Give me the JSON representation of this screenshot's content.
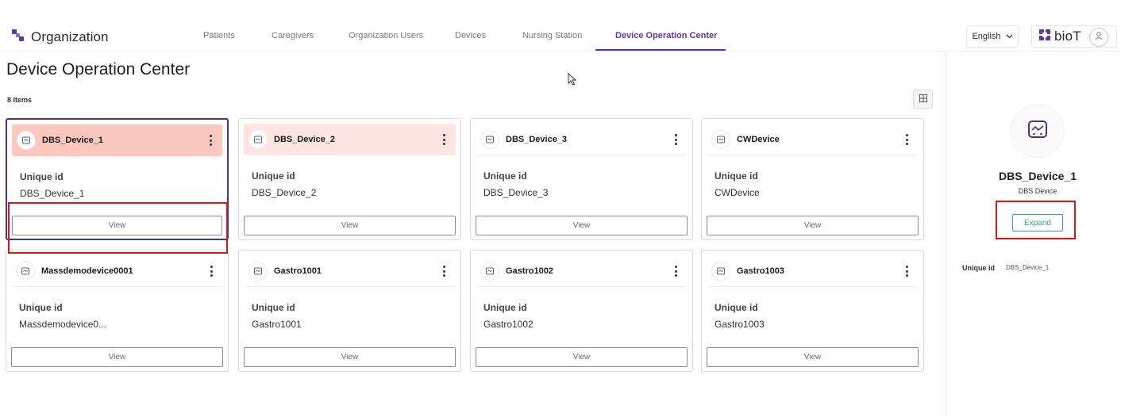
{
  "header": {
    "org_title": "Organization",
    "language": "English",
    "logo_text": "bioT",
    "nav": [
      {
        "label": "Patients",
        "active": false
      },
      {
        "label": "Caregivers",
        "active": false
      },
      {
        "label": "Organization Users",
        "active": false
      },
      {
        "label": "Devices",
        "active": false
      },
      {
        "label": "Nursing Station",
        "active": false
      },
      {
        "label": "Device Operation Center",
        "active": true
      }
    ]
  },
  "page": {
    "title": "Device Operation Center",
    "items_count": "8 Items"
  },
  "cards": [
    {
      "name": "DBS_Device_1",
      "uid_label": "Unique id",
      "uid_value": "DBS_Device_1",
      "view_label": "View",
      "status": "alert-strong",
      "selected": true
    },
    {
      "name": "DBS_Device_2",
      "uid_label": "Unique id",
      "uid_value": "DBS_Device_2",
      "view_label": "View",
      "status": "alert-light",
      "selected": false
    },
    {
      "name": "DBS_Device_3",
      "uid_label": "Unique id",
      "uid_value": "DBS_Device_3",
      "view_label": "View",
      "status": "normal",
      "selected": false
    },
    {
      "name": "CWDevice",
      "uid_label": "Unique id",
      "uid_value": "CWDevice",
      "view_label": "View",
      "status": "normal",
      "selected": false
    },
    {
      "name": "Massdemodevice0001",
      "uid_label": "Unique id",
      "uid_value": "Massdemodevice0...",
      "view_label": "View",
      "status": "normal",
      "selected": false
    },
    {
      "name": "Gastro1001",
      "uid_label": "Unique id",
      "uid_value": "Gastro1001",
      "view_label": "View",
      "status": "normal",
      "selected": false
    },
    {
      "name": "Gastro1002",
      "uid_label": "Unique id",
      "uid_value": "Gastro1002",
      "view_label": "View",
      "status": "normal",
      "selected": false
    },
    {
      "name": "Gastro1003",
      "uid_label": "Unique id",
      "uid_value": "Gastro1003",
      "view_label": "View",
      "status": "normal",
      "selected": false
    }
  ],
  "side_panel": {
    "device_name": "DBS_Device_1",
    "device_type": "DBS Device",
    "expand_label": "Expand",
    "uid_label": "Unique id",
    "uid_value": "DBS_Device_1"
  },
  "icons": {
    "org_logo": "organization-logo-icon",
    "device": "device-monitor-icon",
    "kebab": "kebab-menu-icon",
    "grid": "grid-view-icon",
    "user": "user-icon",
    "chevron": "chevron-down-icon"
  },
  "colors": {
    "accent": "#5b36b0",
    "alert_strong": "#fbc7bf",
    "alert_light": "#fde6e2",
    "expand": "#3aa67a",
    "highlight_box": "#e01414"
  }
}
